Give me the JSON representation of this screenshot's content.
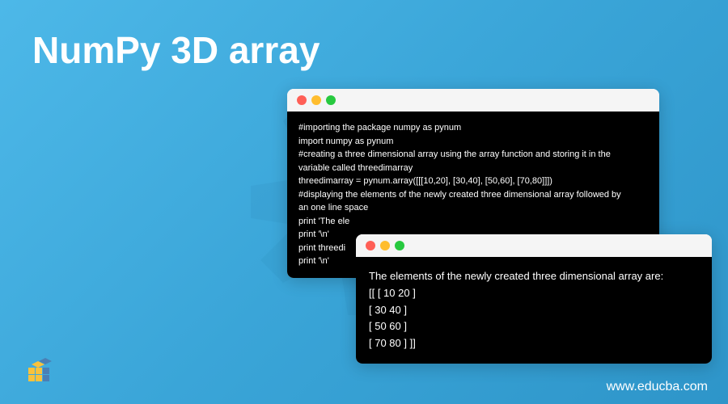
{
  "title": "NumPy 3D array",
  "url": "www.educba.com",
  "window1": {
    "lines": [
      "#importing the package numpy as pynum",
      "import numpy as pynum",
      "#creating a three dimensional array using the array function and storing it in the",
      "variable called threedimarray",
      "threedimarray = pynum.array([[[10,20], [30,40], [50,60], [70,80]]])",
      "#displaying the elements of the newly created three dimensional array followed by",
      "an one line space",
      "print 'The ele",
      "print '\\n'",
      "print threedi",
      "print '\\n'"
    ]
  },
  "window2": {
    "lines": [
      "The elements of the newly created three dimensional array are:",
      "[[ [ 10  20 ]",
      "    [ 30  40 ]",
      "   [ 50  60 ]",
      "   [ 70  80 ] ]]"
    ]
  }
}
